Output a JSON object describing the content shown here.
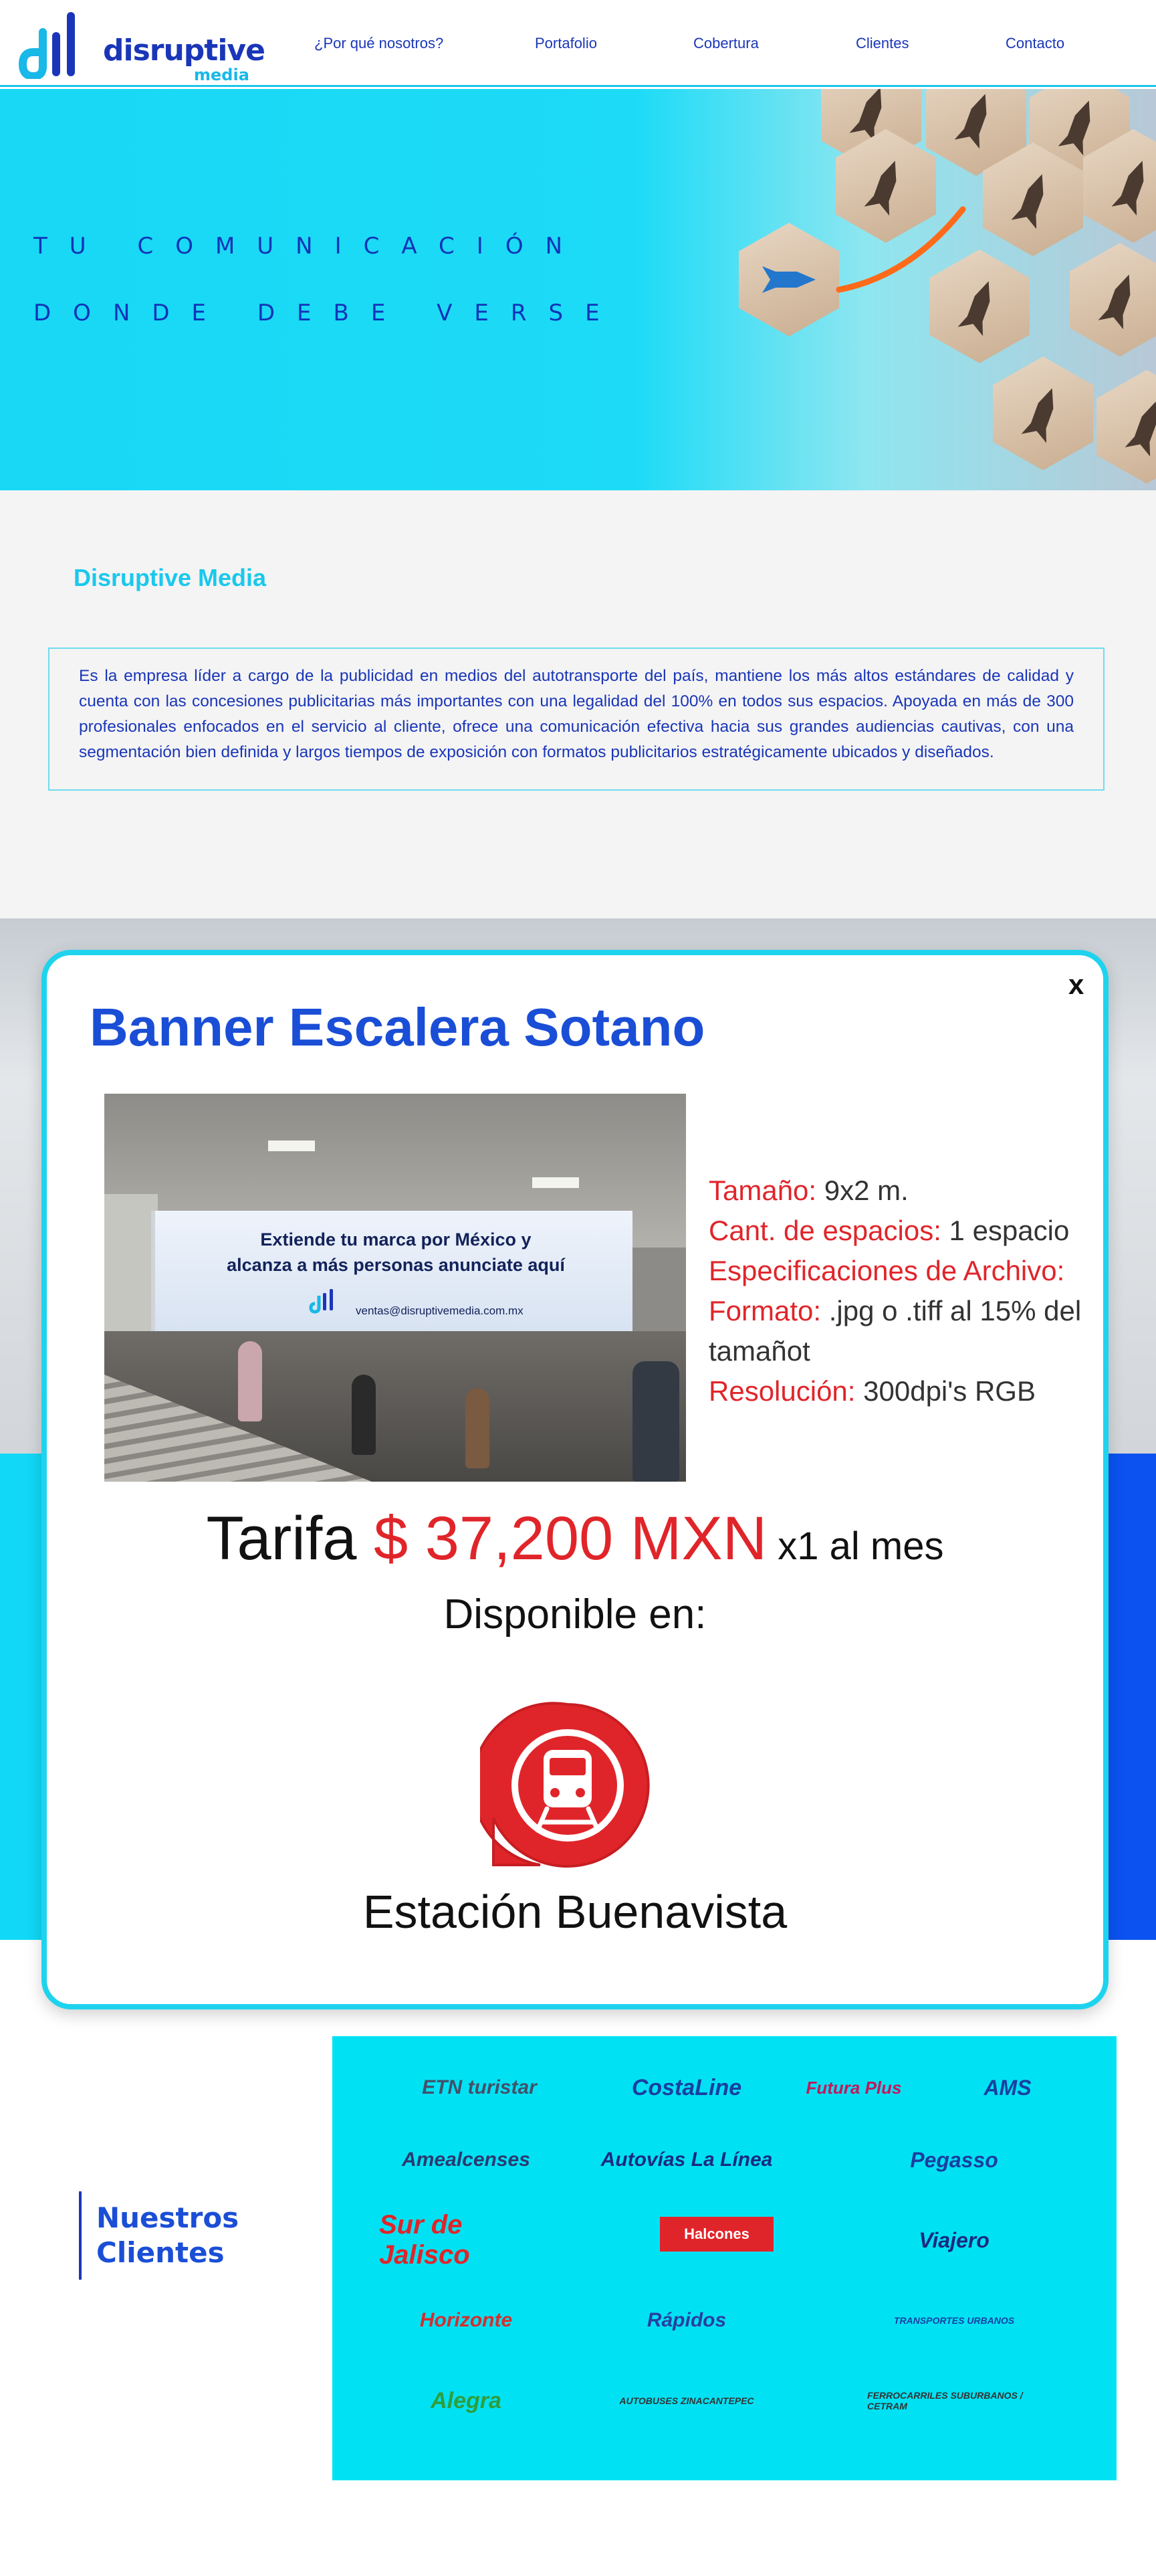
{
  "header": {
    "brand_word": "disruptive",
    "brand_sub": "media",
    "nav": [
      "¿Por qué nosotros?",
      "Portafolio",
      "Cobertura",
      "Clientes",
      "Contacto"
    ]
  },
  "hero": {
    "line1": "TU COMUNICACIÓN",
    "line2": "DONDE DEBE VERSE"
  },
  "about": {
    "title": "Disruptive Media",
    "text": "Es la empresa líder a cargo de la publicidad en medios del  autotransporte del país, mantiene los más altos estándares de calidad y cuenta con las concesiones publicitarias más importantes  con una legalidad del 100% en todos sus espacios. Apoyada en más de 300 profesionales enfocados en el servicio al cliente, ofrece una comunicación efectiva hacia sus grandes audiencias cautivas, con una segmentación bien definida y largos tiempos de exposición con formatos publicitarios estratégicamente ubicados y diseñados."
  },
  "modal": {
    "close": "x",
    "title": "Banner Escalera Sotano",
    "ad": {
      "line1": "Extiende tu marca por México y",
      "line2": "alcanza a más personas anunciate aquí",
      "email": "ventas@disruptivemedia.com.mx"
    },
    "specs": {
      "size_label": "Tamaño:",
      "size_value": " 9x2 m.",
      "spaces_label": "Cant. de espacios:",
      "spaces_value": " 1 espacio",
      "file_label": "Especificaciones de Archivo:",
      "format_label": "Formato:",
      "format_value": " .jpg o .tiff al 15% del tamañot",
      "resolution_label": "Resolución:",
      "resolution_value": " 300dpi's RGB"
    },
    "tarifa_label": "Tarifa ",
    "price": "$ 37,200 MXN",
    "period": " x1 al mes",
    "available": "Disponible en:",
    "station": "Estación Buenavista"
  },
  "clients": {
    "title_line1": "Nuestros",
    "title_line2": "Clientes",
    "logos": [
      {
        "name": "ETN Turistar",
        "text": "ETN turistar",
        "color": "#44506a"
      },
      {
        "name": "Costa Line",
        "text": "CostaLine",
        "color": "#1a3fa0"
      },
      {
        "name": "Futura Plus",
        "text": "Futura Plus",
        "color": "#c2185b"
      },
      {
        "name": "AMS",
        "text": "AMS",
        "color": "#1a3fa0"
      },
      {
        "name": "Amealcenses",
        "text": "Amealcenses",
        "color": "#2a3a70"
      },
      {
        "name": "Autovías La Línea",
        "text": "Autovías La Línea",
        "color": "#1a2a80"
      },
      {
        "name": "Pegasso",
        "text": "Pegasso",
        "color": "#1a3fa0"
      },
      {
        "name": "Sur de Jalisco",
        "text": "Sur de Jalisco",
        "color": "#e0252a"
      },
      {
        "name": "Halcones",
        "text": "Halcones",
        "color": "#ffffff"
      },
      {
        "name": "Viajero",
        "text": "Viajero",
        "color": "#1a2a80"
      },
      {
        "name": "Nuevo Horizonte",
        "text": "Horizonte",
        "color": "#d32f2f"
      },
      {
        "name": "Rápidos",
        "text": "Rápidos",
        "color": "#2a3fa0"
      },
      {
        "name": "Transportes Urbanos",
        "text": "TRANSPORTES URBANOS",
        "color": "#1a3fa0"
      },
      {
        "name": "Alegra",
        "text": "Alegra",
        "color": "#2e9e3e"
      },
      {
        "name": "Autobuses Zinacantepec",
        "text": "AUTOBUSES ZINACANTEPEC",
        "color": "#333333"
      },
      {
        "name": "Ferrocarriles Suburbanos CETRAM",
        "text": "FERROCARRILES SUBURBANOS / CETRAM",
        "color": "#333333"
      }
    ]
  },
  "colors": {
    "cyan": "#1ddbf7",
    "blue": "#1a36b8",
    "accent_red": "#e0252a"
  }
}
